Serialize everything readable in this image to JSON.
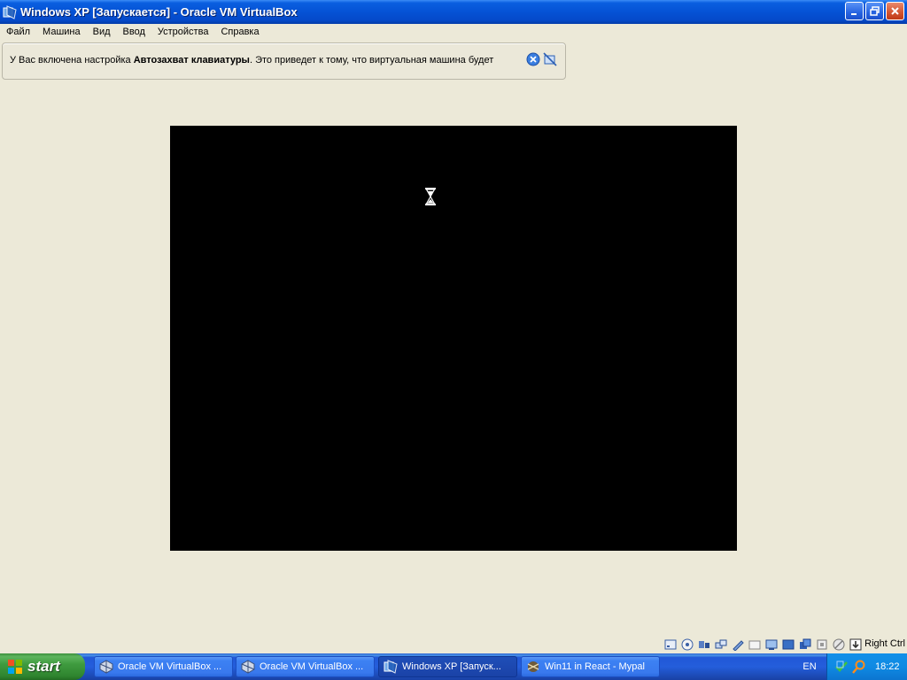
{
  "window": {
    "title": "Windows XP [Запускается] - Oracle VM VirtualBox",
    "app_icon": "virtualbox-icon",
    "controls": {
      "minimize": "minimize-icon",
      "maximize": "restore-icon",
      "close": "close-icon"
    }
  },
  "menu": {
    "items": [
      {
        "label": "Файл"
      },
      {
        "label": "Машина"
      },
      {
        "label": "Вид"
      },
      {
        "label": "Ввод"
      },
      {
        "label": "Устройства"
      },
      {
        "label": "Справка"
      }
    ]
  },
  "banner": {
    "text_before": "У Вас включена настройка ",
    "text_bold": "Автозахват клавиатуры",
    "text_after": ". Это приведет к тому, что виртуальная машина будет",
    "icons": [
      "close-message-icon",
      "dont-show-again-icon"
    ]
  },
  "vm_screen": {
    "background": "#000000",
    "cursor": "hourglass-icon"
  },
  "statusbar": {
    "icons": [
      "hard-disk-icon",
      "optical-drive-icon",
      "audio-icon",
      "network-icon",
      "usb-icon",
      "shared-folders-icon",
      "display-icon",
      "video-capture-icon",
      "video-capture-2-icon",
      "cpu-icon",
      "mouse-integration-icon",
      "keyboard-capture-icon"
    ],
    "host_key": "Right Ctrl"
  },
  "taskbar": {
    "start_label": "start",
    "tasks": [
      {
        "label": "Oracle VM VirtualBox ...",
        "icon": "virtualbox-icon",
        "active": false
      },
      {
        "label": "Oracle VM VirtualBox ...",
        "icon": "virtualbox-icon",
        "active": false
      },
      {
        "label": "Windows XP [Запуск...",
        "icon": "virtualbox-vm-icon",
        "active": true
      },
      {
        "label": "Win11 in React - Mypal",
        "icon": "mypal-browser-icon",
        "active": false
      }
    ],
    "language": "EN",
    "tray_icons": [
      "virtualbox-tray-icon",
      "search-tray-icon"
    ],
    "clock": "18:22"
  },
  "colors": {
    "titlebar_blue": "#0552d5",
    "taskbar_blue": "#245edb",
    "start_green": "#3f9b3f",
    "window_bg": "#ece9d8"
  }
}
